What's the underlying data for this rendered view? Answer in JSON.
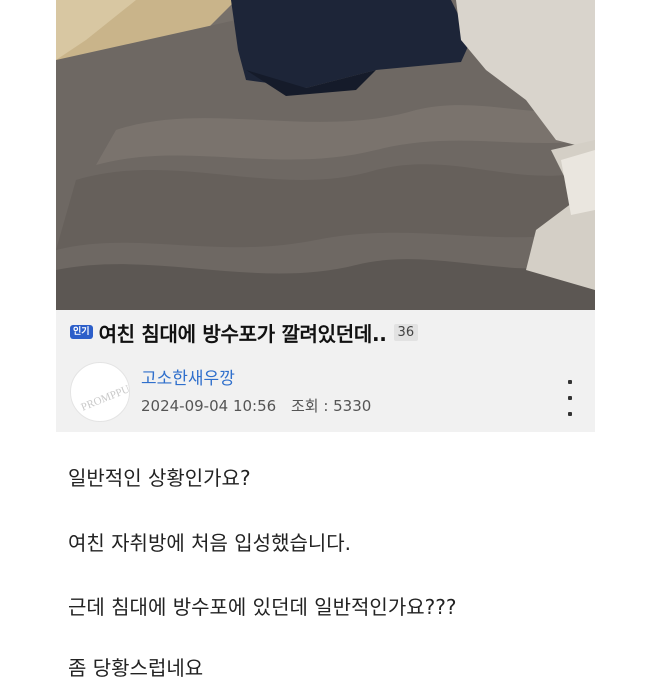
{
  "post": {
    "badge": "인기",
    "title": "여친 침대에 방수포가 깔려있던데..",
    "comment_count": "36",
    "avatar_text": "PROMPPU",
    "author": "고소한새우깡",
    "date": "2024-09-04 10:56",
    "views": "조회 : 5330"
  },
  "content": {
    "lines": [
      "일반적인 상황인가요?",
      "여친 자취방에 처음 입성했습니다.",
      "근데 침대에 방수포에 있던데 일반적인가요???",
      "좀 당황스럽네요"
    ]
  }
}
